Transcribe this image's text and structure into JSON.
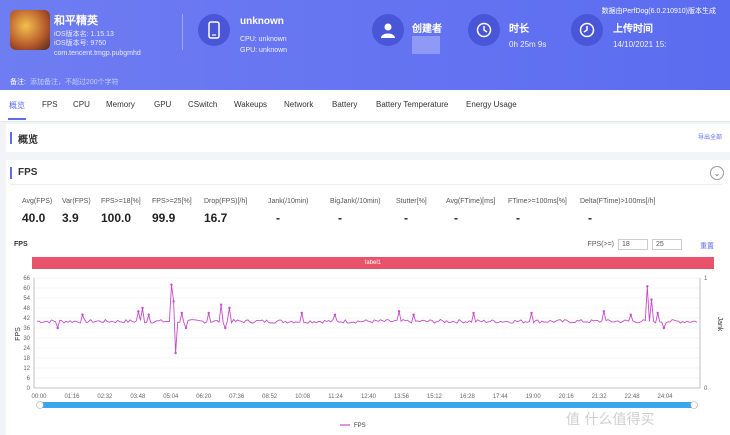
{
  "app": {
    "game_name": "和平精英",
    "ios_version": "iOS版本名: 1.15.13",
    "ios_code": "iOS版本号: 9750",
    "package": "com.tencent.tmgp.pubgmhd",
    "device_name": "unknown",
    "cpu": "CPU: unknown",
    "gpu": "GPU: unknown",
    "creator_label": "创建者",
    "duration_label": "时长",
    "duration_value": "0h 25m 9s",
    "upload_label": "上传时间",
    "upload_value": "14/10/2021 15:",
    "perfdog_version": "数据由PerfDog(6.0.210910)版本生成",
    "note_label": "备注:",
    "note_placeholder": "添加备注，不超过200个字符"
  },
  "tabs": [
    "概览",
    "FPS",
    "CPU",
    "Memory",
    "GPU",
    "CSwitch",
    "Wakeups",
    "Network",
    "Battery",
    "Battery Temperature",
    "Energy Usage"
  ],
  "overview": {
    "title": "概览",
    "export": "导出全部"
  },
  "fps_section": {
    "title": "FPS",
    "collapse_icon": "⌄",
    "stats": [
      {
        "label": "Avg(FPS)",
        "value": "40.0"
      },
      {
        "label": "Var(FPS)",
        "value": "3.9"
      },
      {
        "label": "FPS>=18[%]",
        "value": "100.0"
      },
      {
        "label": "FPS>=25[%]",
        "value": "99.9"
      },
      {
        "label": "Drop(FPS)[/h]",
        "value": "16.7"
      },
      {
        "label": "Jank(/10min)",
        "value": "-"
      },
      {
        "label": "BigJank(/10min)",
        "value": "-"
      },
      {
        "label": "Stutter[%]",
        "value": "-"
      },
      {
        "label": "Avg(FTime)[ms]",
        "value": "-"
      },
      {
        "label": "FTime>=100ms[%]",
        "value": "-"
      },
      {
        "label": "Delta(FTime)>100ms[/h]",
        "value": "-"
      }
    ],
    "chart_title": "FPS",
    "threshold_label": "FPS(>=)",
    "threshold_1": "18",
    "threshold_2": "25",
    "reset_label": "重置",
    "label_bar": "label1",
    "legend": "FPS",
    "watermark": "值 什么值得买"
  },
  "chart_data": {
    "type": "line",
    "title": "FPS",
    "ylabel": "FPS",
    "y2label": "Jank",
    "yticks": [
      0,
      6,
      12,
      18,
      24,
      30,
      36,
      42,
      48,
      54,
      60,
      66
    ],
    "y2ticks": [
      0,
      1
    ],
    "ylim": [
      0,
      66
    ],
    "x_ticks": [
      "00:00",
      "01:16",
      "02:32",
      "03:48",
      "05:04",
      "06:20",
      "07:36",
      "08:52",
      "10:08",
      "11:24",
      "12:40",
      "13:56",
      "15:12",
      "16:28",
      "17:44",
      "19:00",
      "20:16",
      "21:32",
      "22:48",
      "24:04"
    ],
    "series": [
      {
        "name": "FPS",
        "color": "#c84cc8",
        "baseline": 40,
        "spikes": [
          [
            0.16,
            48
          ],
          [
            0.17,
            44
          ],
          [
            0.155,
            34
          ],
          [
            0.155,
            46
          ],
          [
            0.205,
            62
          ],
          [
            0.21,
            21
          ],
          [
            0.207,
            52
          ],
          [
            0.22,
            45
          ],
          [
            0.225,
            36
          ],
          [
            0.28,
            50
          ],
          [
            0.29,
            48
          ],
          [
            0.285,
            36
          ],
          [
            0.26,
            45
          ],
          [
            0.4,
            45
          ],
          [
            0.45,
            44
          ],
          [
            0.55,
            46
          ],
          [
            0.57,
            44
          ],
          [
            0.66,
            45
          ],
          [
            0.75,
            45
          ],
          [
            0.86,
            46
          ],
          [
            0.9,
            44
          ],
          [
            0.925,
            61
          ],
          [
            0.93,
            53
          ],
          [
            0.94,
            45
          ],
          [
            0.95,
            36
          ],
          [
            0.03,
            36
          ],
          [
            0.07,
            44
          ]
        ]
      }
    ],
    "legend_position": "bottom",
    "grid": true
  }
}
